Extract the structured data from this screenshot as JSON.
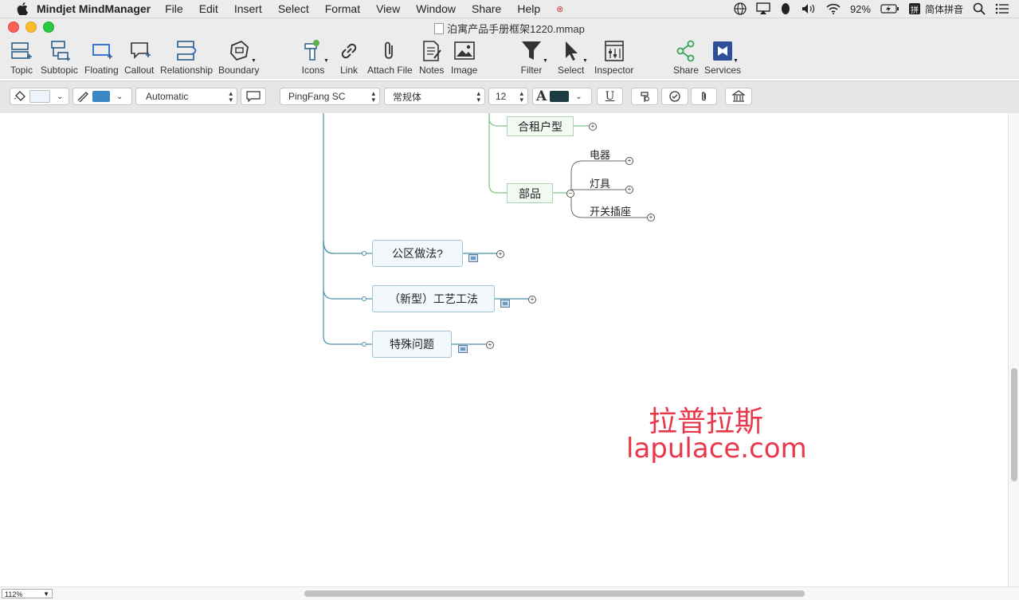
{
  "menubar": {
    "app_name": "Mindjet MindManager",
    "menus": [
      "File",
      "Edit",
      "Insert",
      "Select",
      "Format",
      "View",
      "Window",
      "Share",
      "Help"
    ],
    "battery": "92%",
    "input_method": "简体拼音"
  },
  "window": {
    "title": "泊寓产品手册框架1220.mmap"
  },
  "toolbar": {
    "topic": "Topic",
    "subtopic": "Subtopic",
    "floating": "Floating",
    "callout": "Callout",
    "relationship": "Relationship",
    "boundary": "Boundary",
    "icons": "Icons",
    "link": "Link",
    "attach_file": "Attach File",
    "notes": "Notes",
    "image": "Image",
    "filter": "Filter",
    "select": "Select",
    "inspector": "Inspector",
    "share": "Share",
    "services": "Services"
  },
  "formatbar": {
    "layout_select": "Automatic",
    "font_family": "PingFang SC",
    "font_style": "常规体",
    "font_size": "12",
    "fill_color": "#eef4fb",
    "line_color": "#3b87c4",
    "text_color": "#1d3b40",
    "underline": "U"
  },
  "mindmap": {
    "branches": [
      {
        "label": "合租户型"
      },
      {
        "label": "部品",
        "children": [
          "电器",
          "灯具",
          "开关插座"
        ]
      },
      {
        "label": "公区做法?"
      },
      {
        "label": "（新型）工艺工法"
      },
      {
        "label": "特殊问题"
      }
    ]
  },
  "watermark": {
    "chinese": "拉普拉斯",
    "url": "lapulace.com"
  },
  "status": {
    "zoom": "112%"
  },
  "colors": {
    "accent_red": "#e8364b",
    "connector_blue": "#4a8fa8",
    "connector_green": "#7cc483"
  }
}
